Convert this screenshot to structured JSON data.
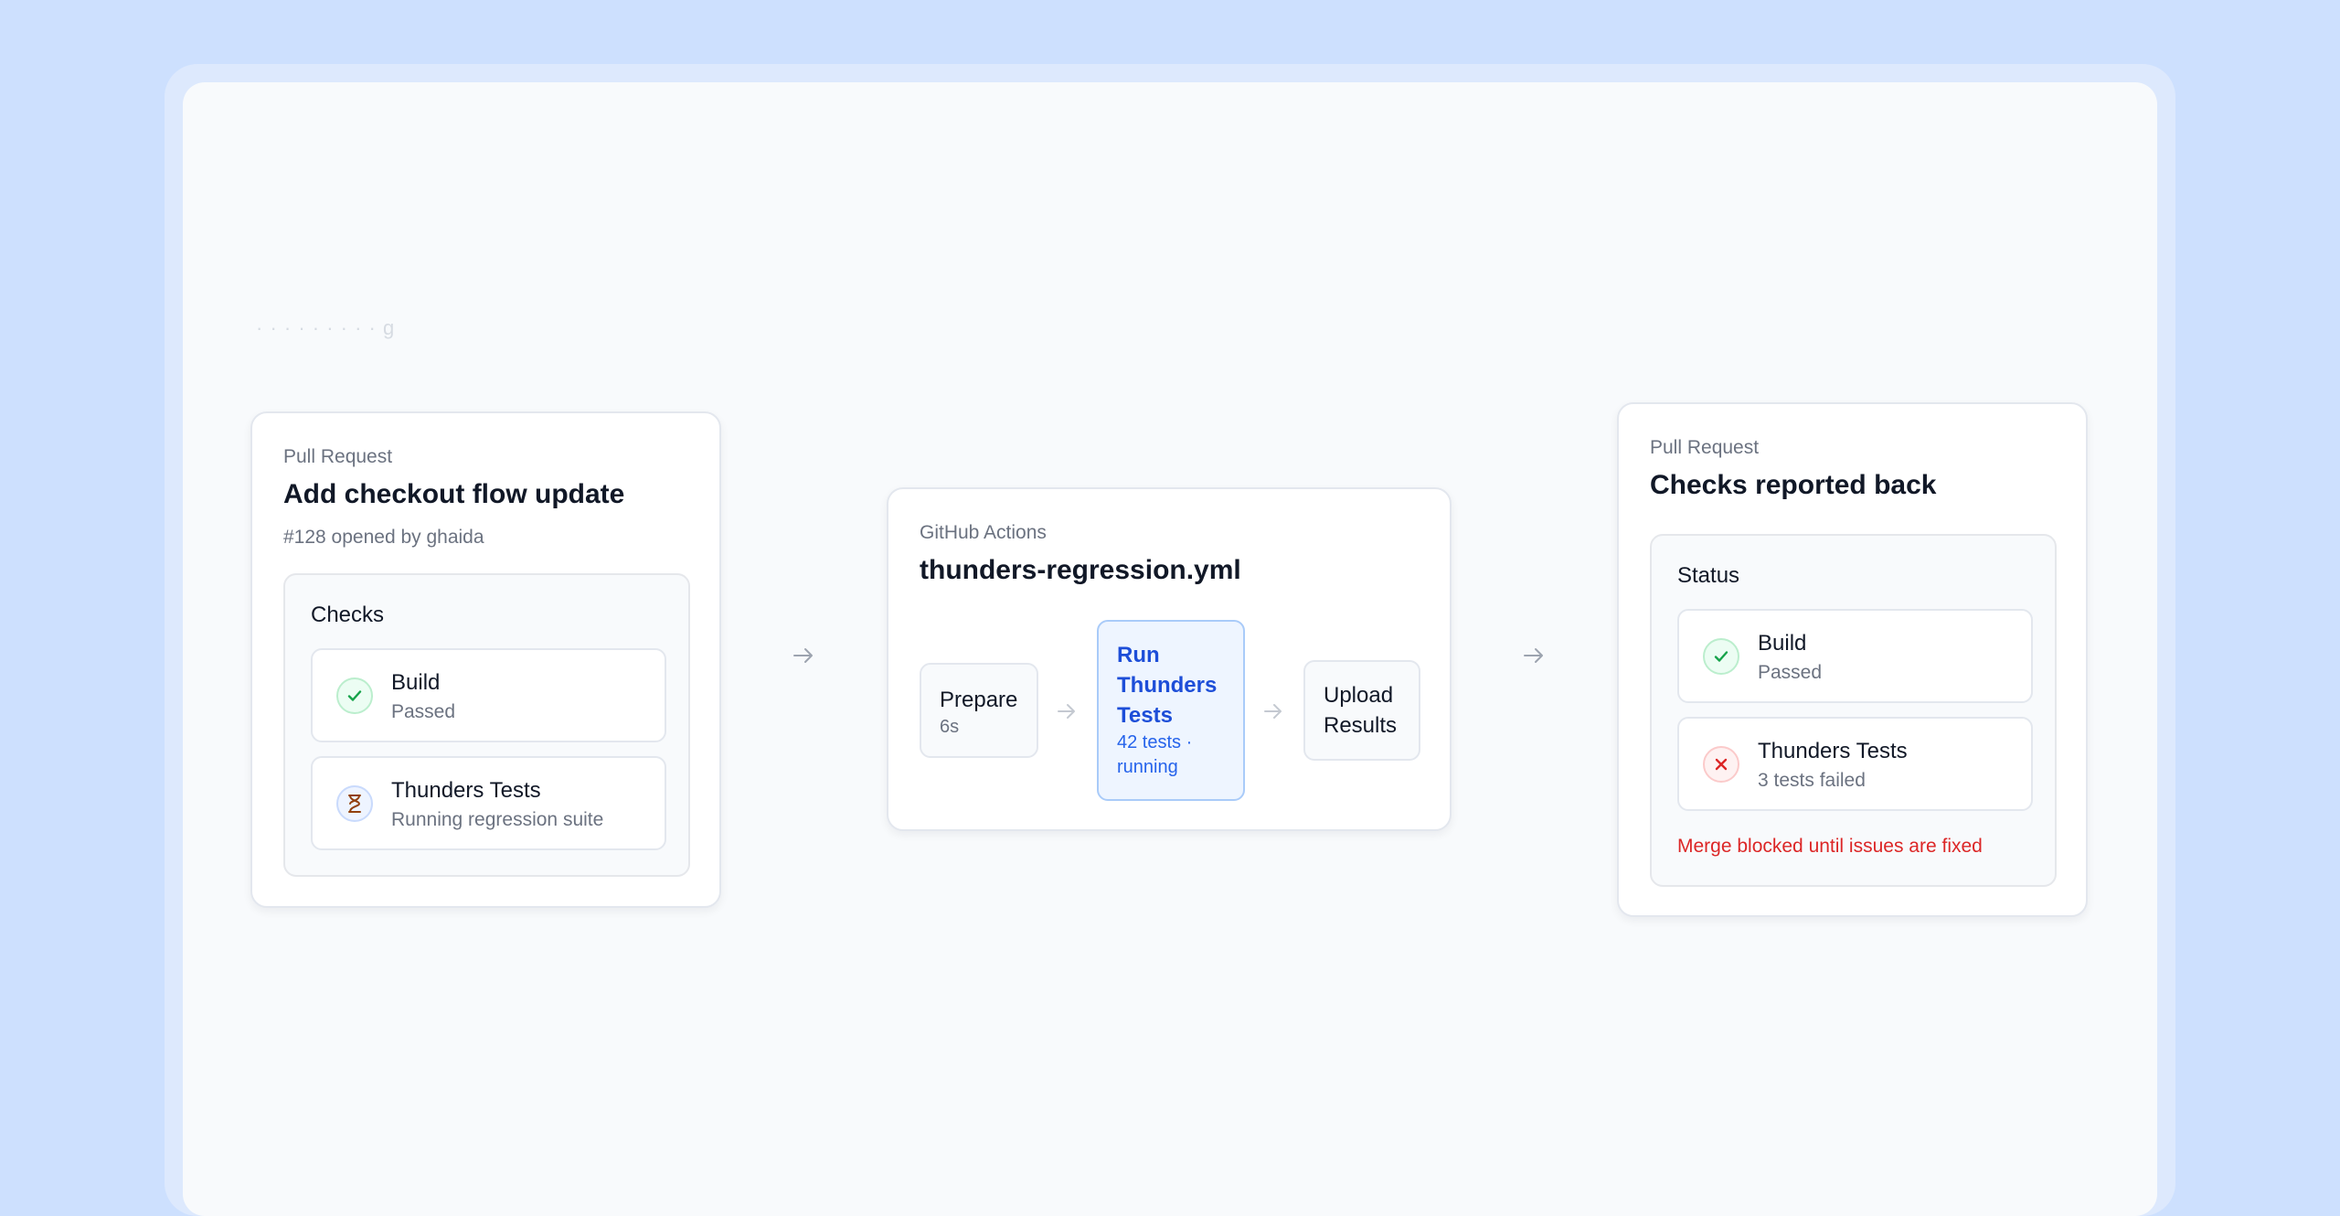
{
  "source_card": {
    "eyebrow": "Pull Request",
    "title": "Add checkout flow update",
    "subtitle": "#128 opened by ghaida",
    "panel_title": "Checks",
    "checks": [
      {
        "name": "Build",
        "status": "Passed",
        "state": "passed",
        "icon": "check-icon"
      },
      {
        "name": "Thunders Tests",
        "status": "Running regression suite",
        "state": "running",
        "icon": "hourglass-icon"
      }
    ]
  },
  "workflow_card": {
    "eyebrow": "GitHub Actions",
    "title": "thunders-regression.yml",
    "steps": [
      {
        "name": "Prepare",
        "detail": "6s",
        "state": "done"
      },
      {
        "name": "Run Thunders Tests",
        "detail": "42 tests · running",
        "state": "active"
      },
      {
        "name": "Upload Results",
        "detail": "",
        "state": "pending"
      }
    ]
  },
  "result_card": {
    "eyebrow": "Pull Request",
    "title": "Checks reported back",
    "panel_title": "Status",
    "checks": [
      {
        "name": "Build",
        "status": "Passed",
        "state": "passed",
        "icon": "check-icon"
      },
      {
        "name": "Thunders Tests",
        "status": "3 tests failed",
        "state": "failed",
        "icon": "x-icon"
      }
    ],
    "merge_message": "Merge blocked until issues are fixed"
  },
  "icons": {
    "flow_arrow": "arrow-right-icon"
  },
  "colors": {
    "background": "#cde0fe",
    "canvas": "#f8fafc",
    "success": "#16a34a",
    "danger": "#dc2626",
    "accent": "#1d4ed8"
  }
}
